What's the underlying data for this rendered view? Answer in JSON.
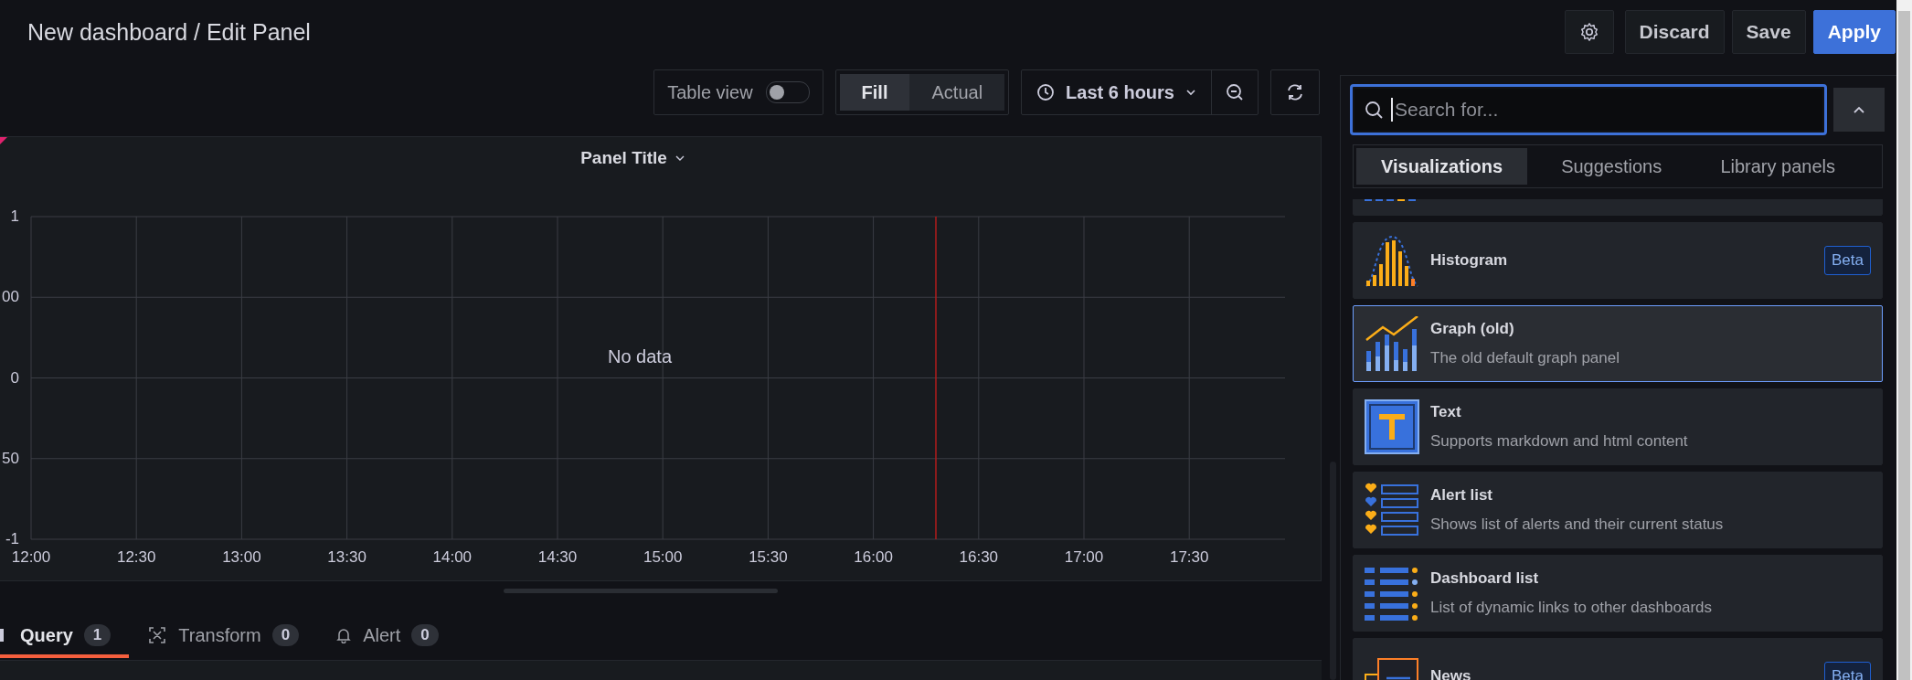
{
  "header": {
    "title": "New dashboard / Edit Panel",
    "buttons": [
      {
        "label": "Discard",
        "primary": false
      },
      {
        "label": "Save",
        "primary": false
      },
      {
        "label": "Apply",
        "primary": true
      }
    ]
  },
  "toolbar": {
    "table_view": {
      "label": "Table view",
      "on": false
    },
    "fill_modes": [
      {
        "label": "Fill",
        "selected": true
      },
      {
        "label": "Actual",
        "selected": false
      }
    ],
    "time_range": "Last 6 hours"
  },
  "panel": {
    "title": "Panel Title",
    "message": "No data",
    "y_labels": [
      "1",
      "00",
      "0",
      "50",
      "-1"
    ],
    "x_labels": [
      "12:00",
      "12:30",
      "13:00",
      "13:30",
      "14:00",
      "14:30",
      "15:00",
      "15:30",
      "16:00",
      "16:30",
      "17:00",
      "17:30"
    ]
  },
  "editor_tabs": [
    {
      "label": "Query",
      "count": "1",
      "selected": true,
      "kind": "query"
    },
    {
      "label": "Transform",
      "count": "0",
      "selected": false,
      "kind": "transform"
    },
    {
      "label": "Alert",
      "count": "0",
      "selected": false,
      "kind": "alert"
    }
  ],
  "viz_picker": {
    "search_placeholder": "Search for...",
    "tabs": [
      {
        "label": "Visualizations",
        "selected": true
      },
      {
        "label": "Suggestions",
        "selected": false
      },
      {
        "label": "Library panels",
        "selected": false
      }
    ],
    "items": [
      {
        "kind": "histogram",
        "name": "Histogram",
        "badge": "Beta",
        "selected": false
      },
      {
        "kind": "graph",
        "name": "Graph (old)",
        "description": "The old default graph panel",
        "selected": true
      },
      {
        "kind": "text",
        "name": "Text",
        "description": "Supports markdown and html content",
        "selected": false
      },
      {
        "kind": "alert-list",
        "name": "Alert list",
        "description": "Shows list of alerts and their current status",
        "selected": false
      },
      {
        "kind": "dashboard-list",
        "name": "Dashboard list",
        "description": "List of dynamic links to other dashboards",
        "selected": false
      },
      {
        "kind": "news",
        "name": "News",
        "badge": "Beta",
        "selected": false
      }
    ]
  }
}
